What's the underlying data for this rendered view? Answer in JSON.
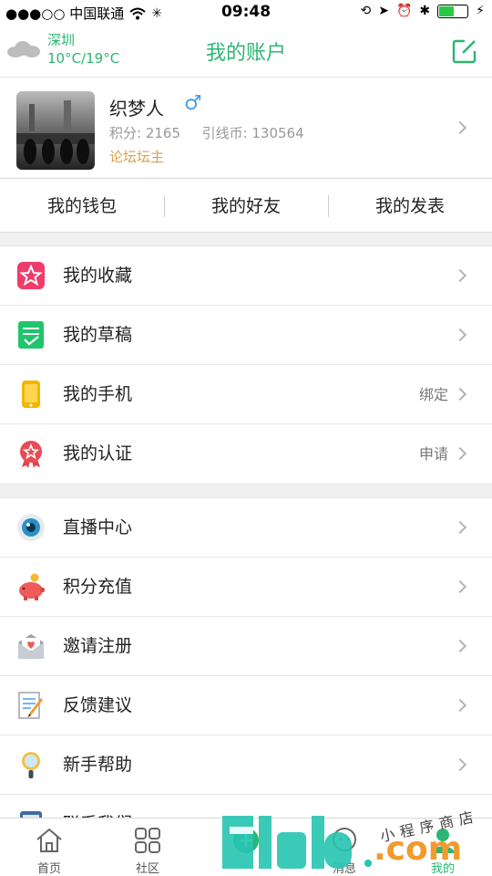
{
  "status": {
    "carrier": "●●●○○ 中国联通",
    "time": "09:48",
    "battery_level": 0.55
  },
  "nav": {
    "city": "深圳",
    "temp": "10°C/19°C",
    "title": "我的账户",
    "edit_icon": "edit-icon"
  },
  "profile": {
    "name": "织梦人",
    "gender_symbol": "♂",
    "points": "积分: 2165",
    "coins": "引线币: 130564",
    "role": "论坛坛主"
  },
  "quicklinks": [
    "我的钱包",
    "我的好友",
    "我的发表"
  ],
  "group1": [
    {
      "label": "我的收藏",
      "value": "",
      "icon": "star-icon"
    },
    {
      "label": "我的草稿",
      "value": "",
      "icon": "draft-icon"
    },
    {
      "label": "我的手机",
      "value": "绑定",
      "icon": "phone-icon"
    },
    {
      "label": "我的认证",
      "value": "申请",
      "icon": "badge-icon"
    }
  ],
  "group2": [
    {
      "label": "直播中心",
      "value": "",
      "icon": "eye-icon"
    },
    {
      "label": "积分充值",
      "value": "",
      "icon": "piggy-bank-icon"
    },
    {
      "label": "邀请注册",
      "value": "",
      "icon": "envelope-heart-icon"
    },
    {
      "label": "反馈建议",
      "value": "",
      "icon": "memo-icon"
    },
    {
      "label": "新手帮助",
      "value": "",
      "icon": "magnifier-icon"
    },
    {
      "label": "联系我们",
      "value": "",
      "icon": "contact-icon"
    }
  ],
  "tabs": [
    {
      "label": "首页",
      "icon": "home-icon"
    },
    {
      "label": "社区",
      "icon": "grid-icon"
    },
    {
      "label": "",
      "icon": "add-icon"
    },
    {
      "label": "消息",
      "icon": "message-icon"
    },
    {
      "label": "我的",
      "icon": "user-icon"
    }
  ],
  "watermark": {
    "text": "小程序商店",
    "domain": ".com"
  },
  "colors": {
    "accent": "#2bb673",
    "role": "#d9a14a",
    "male": "#4a9ee8"
  }
}
